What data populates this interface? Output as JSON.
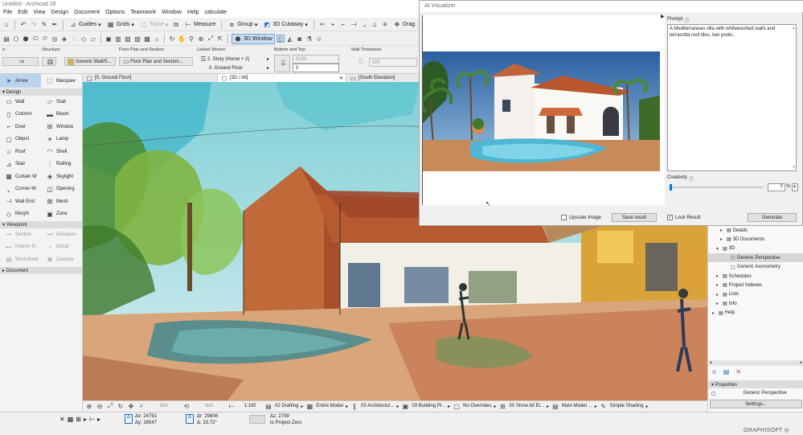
{
  "app": {
    "title": "Untitled - Archicad 28"
  },
  "menu": [
    "File",
    "Edit",
    "View",
    "Design",
    "Document",
    "Options",
    "Teamwork",
    "Window",
    "Help",
    "calculate"
  ],
  "toolbar1": {
    "guides": "Guides",
    "grids": "Grids",
    "trace": "Trace",
    "measure": "Measure",
    "group": "Group",
    "cutaway": "3D Cutaway",
    "drag": "Drag"
  },
  "toolbar2": {
    "window3d": "3D Window"
  },
  "infobox": {
    "s_label": "s:",
    "structure_label": "Structure:",
    "structure_value": "Generic Wall/S...",
    "floorplan_label": "Floor Plan and Section:",
    "floorplan_value": "Floor Plan and Section...",
    "linked_label": "Linked Stories:",
    "story1": "2. Story (Home + 2)",
    "story0": "0. Ground Floor",
    "bottomtop_label": "Bottom and Top:",
    "top_value": "5298",
    "bottom_value": "0",
    "thickness_label": "Wall Thickness:",
    "thickness_value": "300"
  },
  "toolbox": {
    "arrow": "Arrow",
    "marquee": "Marquee",
    "design_header": "Design",
    "items": [
      [
        "Wall",
        "Slab"
      ],
      [
        "Column",
        "Beam"
      ],
      [
        "Door",
        "Window"
      ],
      [
        "Object",
        "Lamp"
      ],
      [
        "Roof",
        "Shell"
      ],
      [
        "Stair",
        "Railing"
      ],
      [
        "Curtain W",
        "Skylight"
      ],
      [
        "Corner-W",
        "Opening"
      ],
      [
        "Wall End",
        "Mesh"
      ],
      [
        "Morph",
        "Zone"
      ]
    ],
    "viewpoint_header": "Viewpoint",
    "viewpoint_items": [
      [
        "Section",
        "Elevation"
      ],
      [
        "Interior El",
        "Detail"
      ],
      [
        "Worksheet",
        "Camera"
      ]
    ],
    "document_header": "Document"
  },
  "tabs": [
    "[0. Ground Floor]",
    "[3D / All]",
    "[South Elevation]"
  ],
  "dialog": {
    "title": "AI Visualizer",
    "prompt_label": "Prompt",
    "prompt_text": "A Mediterranean villa with whitewashed walls and terracotta roof tiles, two pools.",
    "creativity_label": "Creativity",
    "creativity_value": "0",
    "creativity_unit": "%",
    "creativity_level": 0,
    "upscale_label": "Upscale Image",
    "save_label": "Save result",
    "lock_label": "Lock Result",
    "generate_label": "Generate"
  },
  "navigator": {
    "items": [
      {
        "label": "Details",
        "indent": 1
      },
      {
        "label": "3D Documents",
        "indent": 1
      },
      {
        "label": "3D",
        "indent": 0
      },
      {
        "label": "Generic Perspective",
        "indent": 2,
        "selected": true
      },
      {
        "label": "Generic Axonometry",
        "indent": 2
      },
      {
        "label": "Schedules",
        "indent": 0
      },
      {
        "label": "Project Indexes",
        "indent": 0
      },
      {
        "label": "Lists",
        "indent": 0
      },
      {
        "label": "Info",
        "indent": 0
      },
      {
        "label": "Help",
        "indent": -1
      }
    ],
    "properties_header": "Properties",
    "properties_value": "Generic Perspective",
    "settings_label": "Settings..."
  },
  "status1": {
    "na1": "N/A",
    "na2": "N/A",
    "scale": "1:100",
    "layer": "02 Drafting",
    "model": "Entire Model",
    "arch": "03 Architectur...",
    "building": "03 Building Pl...",
    "overrides": "No Overrides",
    "show": "00 Show All El...",
    "mainmodel": "Main Model ...",
    "shading": "Simple Shading"
  },
  "status2": {
    "dx": "Δx: 24791",
    "dy": "Δy: 16547",
    "dr": "Δr: 29806",
    "da": "Δ: 33.72°",
    "dz": "Δz: 2799",
    "ref": "to Project Zero",
    "brand": "GRAPHISOFT"
  },
  "colors": {
    "accent": "#0078d7",
    "selection": "#bcd3ee",
    "brand": "#555555"
  }
}
